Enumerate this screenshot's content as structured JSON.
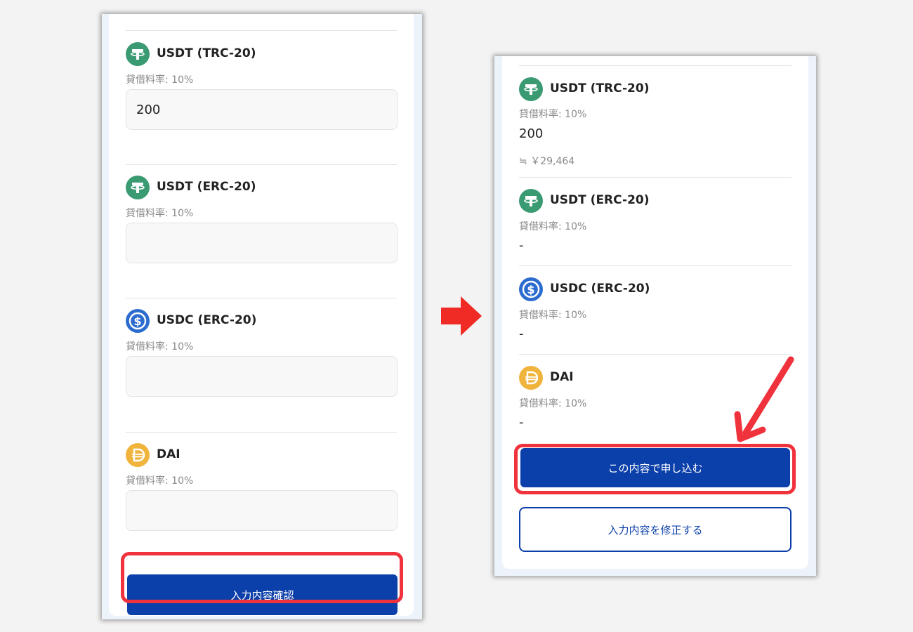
{
  "colors": {
    "usdt": "#3a9a72",
    "usdc": "#2d6ccf",
    "dai": "#f0b43c",
    "primary": "#0b3fa9",
    "highlight": "#f0323c"
  },
  "input_form": {
    "coins": [
      {
        "name": "USDT (TRC-20)",
        "rate": "貸借料率: 10%",
        "value": "200",
        "icon": "tether-icon"
      },
      {
        "name": "USDT (ERC-20)",
        "rate": "貸借料率: 10%",
        "value": "",
        "icon": "tether-icon"
      },
      {
        "name": "USDC (ERC-20)",
        "rate": "貸借料率: 10%",
        "value": "",
        "icon": "usdc-icon"
      },
      {
        "name": "DAI",
        "rate": "貸借料率: 10%",
        "value": "",
        "icon": "dai-icon"
      }
    ],
    "confirm_button": "入力内容確認"
  },
  "confirm_view": {
    "coins": [
      {
        "name": "USDT (TRC-20)",
        "rate": "貸借料率: 10%",
        "value": "200",
        "approx": "≒ ￥29,464",
        "icon": "tether-icon"
      },
      {
        "name": "USDT (ERC-20)",
        "rate": "貸借料率: 10%",
        "value": "-",
        "icon": "tether-icon"
      },
      {
        "name": "USDC (ERC-20)",
        "rate": "貸借料率: 10%",
        "value": "-",
        "icon": "usdc-icon"
      },
      {
        "name": "DAI",
        "rate": "貸借料率: 10%",
        "value": "-",
        "icon": "dai-icon"
      }
    ],
    "apply_button": "この内容で申し込む",
    "edit_button": "入力内容を修正する"
  }
}
